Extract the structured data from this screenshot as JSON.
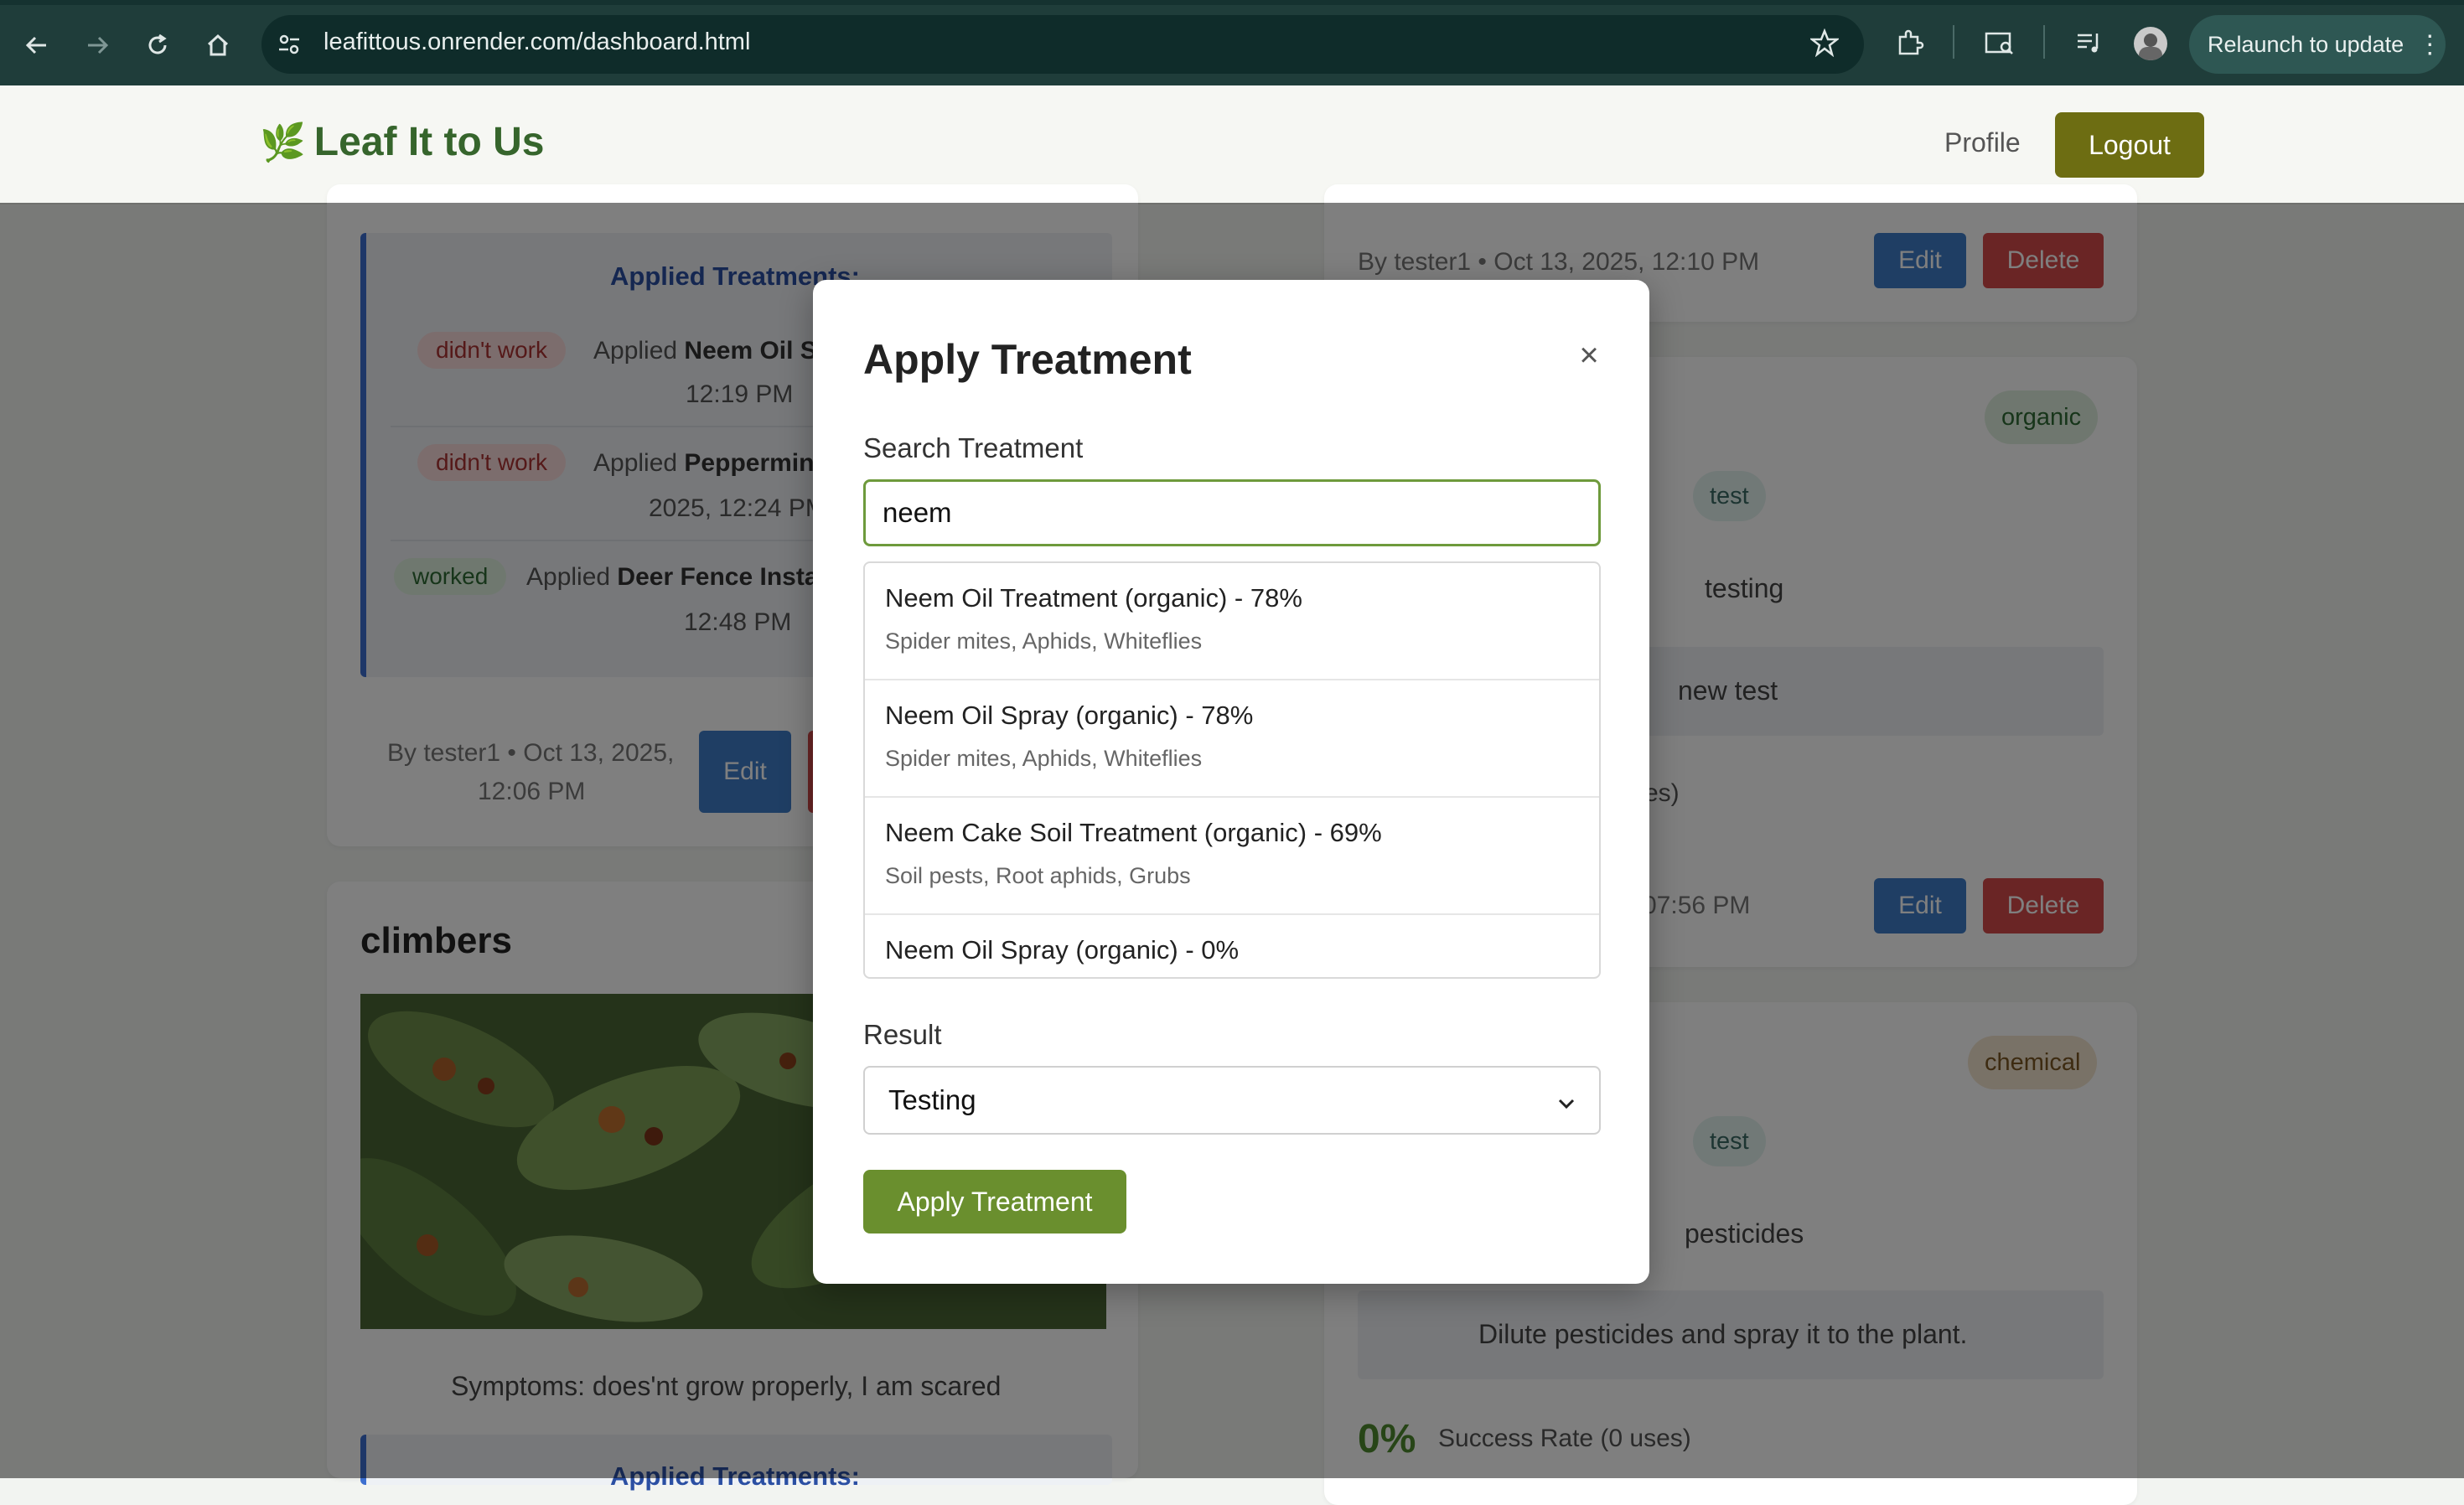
{
  "browser": {
    "url": "leafittous.onrender.com/dashboard.html",
    "relaunch_label": "Relaunch to update"
  },
  "header": {
    "logo_icon": "🌿",
    "logo_text": "Leaf It to Us",
    "profile_label": "Profile",
    "logout_label": "Logout"
  },
  "left_card": {
    "applied_title": "Applied Treatments:",
    "entries": [
      {
        "status": "didn't work",
        "line1_prefix": "Applied ",
        "line1_bold": "Neem Oil S",
        "line2": "12:19 PM"
      },
      {
        "status": "didn't work",
        "line1_prefix": "Applied ",
        "line1_bold": "Peppermin",
        "line2": "2025, 12:24 PM"
      },
      {
        "status": "worked",
        "line1_prefix": "Applied ",
        "line1_bold": "Deer Fence Insta",
        "line2": "12:48 PM"
      }
    ],
    "byline_1": "By tester1 • Oct 13, 2025,",
    "byline_2": "12:06 PM",
    "edit_label": "Edit"
  },
  "climbers_card": {
    "title": "climbers",
    "symptoms": "Symptoms: does'nt grow properly, I am scared",
    "applied_title": "Applied Treatments:"
  },
  "right_cards": {
    "card1": {
      "byline": "By tester1 • Oct 13, 2025, 12:10 PM",
      "edit_label": "Edit",
      "delete_label": "Delete"
    },
    "card2": {
      "type_tag": "organic",
      "target_tag": "test",
      "name": "testing",
      "instructions": "new test",
      "rate_tail": "es)",
      "byline_tail": "07:56 PM",
      "edit_label": "Edit",
      "delete_label": "Delete"
    },
    "card3": {
      "type_tag": "chemical",
      "target_tag": "test",
      "name": "pesticides",
      "instructions": "Dilute pesticides and spray it to the plant.",
      "rate": "0%",
      "rate_label": "Success Rate (0 uses)"
    }
  },
  "modal": {
    "title": "Apply Treatment",
    "close_symbol": "×",
    "search_label": "Search Treatment",
    "search_value": "neem",
    "results": [
      {
        "name": "Neem Oil Treatment (organic) - 78%",
        "pests": "Spider mites, Aphids, Whiteflies"
      },
      {
        "name": "Neem Oil Spray (organic) - 78%",
        "pests": "Spider mites, Aphids, Whiteflies"
      },
      {
        "name": "Neem Cake Soil Treatment (organic) - 69%",
        "pests": "Soil pests, Root aphids, Grubs"
      },
      {
        "name": "Neem Oil Spray (organic) - 0%",
        "pests": ""
      }
    ],
    "result_label": "Result",
    "result_selected": "Testing",
    "apply_label": "Apply Treatment"
  },
  "colors": {
    "brand_green": "#36652c",
    "logout_olive": "#6d6d12",
    "apply_green": "#6a8f2e",
    "edit_blue": "#3e7dc8",
    "delete_red": "#d44b4b"
  }
}
